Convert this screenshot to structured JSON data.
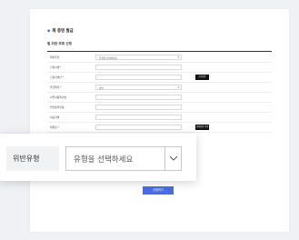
{
  "page": {
    "title": "제 증명 발급",
    "section_title": "법 위반 조회 신청",
    "submit_label": "신청하기",
    "accent_color": "#4a6ae8"
  },
  "form": {
    "rows": [
      {
        "label": "위반유형",
        "value": "유형을 선택하세요",
        "type": "select"
      },
      {
        "label": "신청자명 *",
        "value": "",
        "type": "input"
      },
      {
        "label": "신청자생년 *",
        "value": "",
        "type": "input",
        "button": "본인인증"
      },
      {
        "label": "발급목적 *",
        "value": "선택",
        "type": "select"
      },
      {
        "label": "사업자등록번호",
        "value": "",
        "type": "input"
      },
      {
        "label": "법인등록번호",
        "value": "",
        "type": "input"
      },
      {
        "label": "대표자명",
        "value": "",
        "type": "input"
      },
      {
        "label": "위원장 *",
        "value": "",
        "type": "input",
        "button": "위원장명 검색"
      }
    ]
  },
  "zoom": {
    "label": "위반유형",
    "select_value": "유형을 선택하세요",
    "icon": "chevron-down-icon"
  }
}
